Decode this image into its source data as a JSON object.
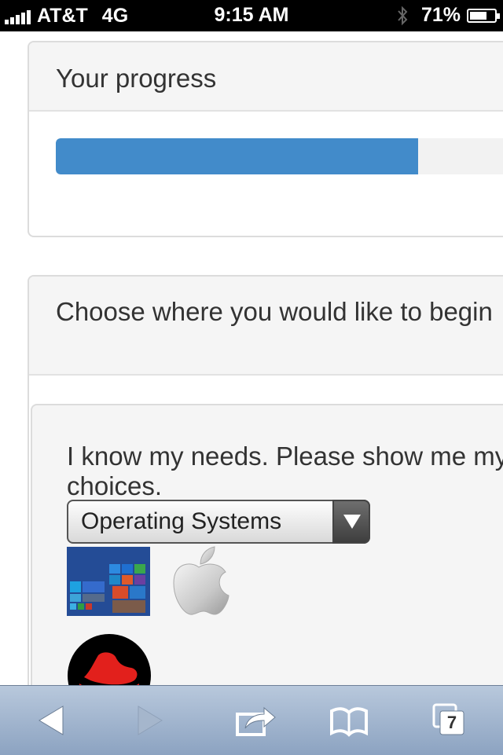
{
  "status_bar": {
    "carrier": "AT&T",
    "network": "4G",
    "time": "9:15 AM",
    "battery": "71%",
    "battery_level": 0.71
  },
  "progress_panel": {
    "title": "Your progress",
    "progress_fraction": 0.72,
    "bar_color": "#428bca"
  },
  "choose_panel": {
    "title": "Choose where you would like to begin",
    "card": {
      "text": "I know my needs. Please show me my choices.",
      "select": {
        "selected": "Operating Systems"
      },
      "os_options": [
        {
          "name": "windows-8-icon"
        },
        {
          "name": "apple-icon"
        },
        {
          "name": "red-hat-icon"
        }
      ]
    }
  },
  "toolbar": {
    "tabs_count": "7",
    "icons": [
      "back-icon",
      "forward-icon",
      "share-icon",
      "bookmarks-icon",
      "tabs-icon"
    ]
  }
}
